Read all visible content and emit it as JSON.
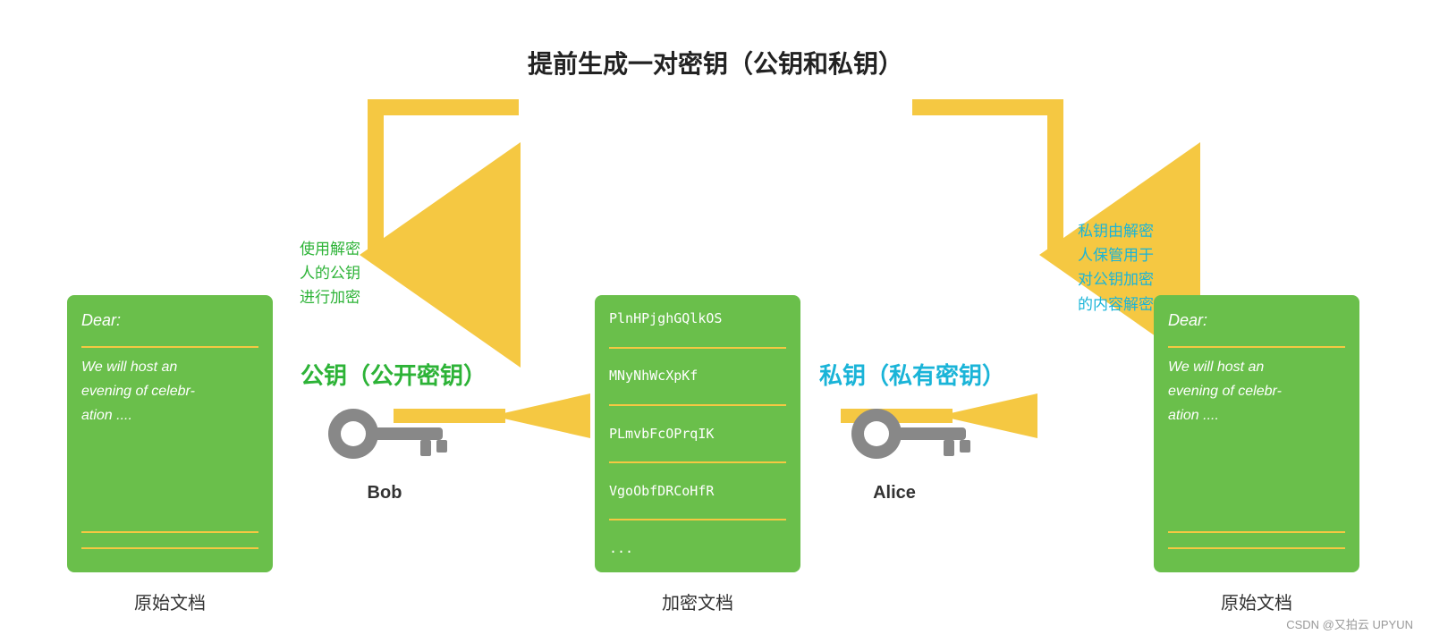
{
  "title": "提前生成一对密钥（公钥和私钥）",
  "annot_left_green": "使用解密\n人的公钥\n进行加密",
  "annot_right_blue": "私钥由解密\n人保管用于\n对公钥加密\n的内容解密",
  "public_key_label": "公钥（公开密钥）",
  "private_key_label": "私钥（私有密钥）",
  "bob_label": "Bob",
  "alice_label": "Alice",
  "doc_left_label": "原始文档",
  "doc_center_label": "加密文档",
  "doc_right_label": "原始文档",
  "doc_dear": "Dear:",
  "doc_text": "We will host an\nevening of celebr-\nation ....",
  "enc_lines": [
    "PlnHPjghGQlkOS",
    "MNyNhWcXpKf",
    "PLmvbFcOPrqIK",
    "VgoObfDRCoHfR",
    "..."
  ],
  "watermark": "CSDN @又拍云 UPYUN"
}
